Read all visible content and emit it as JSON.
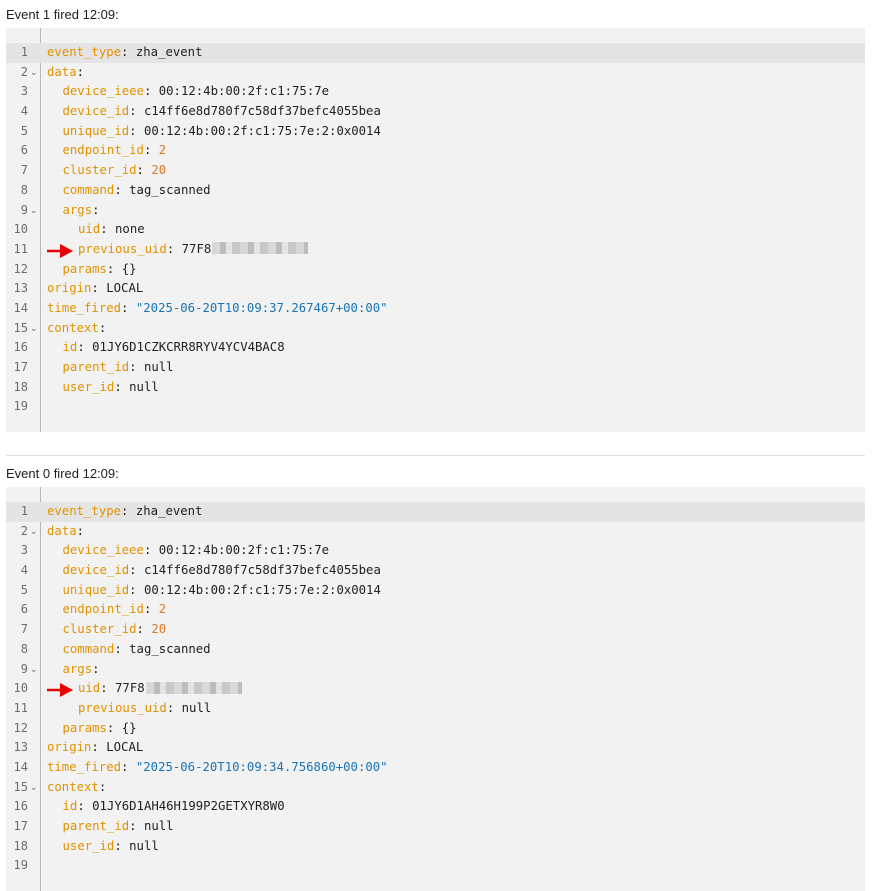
{
  "events": [
    {
      "title": "Event 1 fired 12:09:",
      "marked_line": 11,
      "lines": [
        {
          "n": "1",
          "indent": 0,
          "key": "event_type",
          "value": "zha_event",
          "vtype": "plain",
          "fold": false
        },
        {
          "n": "2",
          "indent": 0,
          "key": "data",
          "value": "",
          "vtype": "plain",
          "fold": true
        },
        {
          "n": "3",
          "indent": 1,
          "key": "device_ieee",
          "value": "00:12:4b:00:2f:c1:75:7e",
          "vtype": "plain",
          "fold": false
        },
        {
          "n": "4",
          "indent": 1,
          "key": "device_id",
          "value": "c14ff6e8d780f7c58df37befc4055bea",
          "vtype": "plain",
          "fold": false
        },
        {
          "n": "5",
          "indent": 1,
          "key": "unique_id",
          "value": "00:12:4b:00:2f:c1:75:7e:2:0x0014",
          "vtype": "plain",
          "fold": false
        },
        {
          "n": "6",
          "indent": 1,
          "key": "endpoint_id",
          "value": "2",
          "vtype": "number",
          "fold": false
        },
        {
          "n": "7",
          "indent": 1,
          "key": "cluster_id",
          "value": "20",
          "vtype": "number",
          "fold": false
        },
        {
          "n": "8",
          "indent": 1,
          "key": "command",
          "value": "tag_scanned",
          "vtype": "plain",
          "fold": false
        },
        {
          "n": "9",
          "indent": 1,
          "key": "args",
          "value": "",
          "vtype": "plain",
          "fold": true
        },
        {
          "n": "10",
          "indent": 2,
          "key": "uid",
          "value": "none",
          "vtype": "plain",
          "fold": false
        },
        {
          "n": "11",
          "indent": 2,
          "key": "previous_uid",
          "value": "77F8",
          "vtype": "redacted",
          "fold": false
        },
        {
          "n": "12",
          "indent": 1,
          "key": "params",
          "value": "{}",
          "vtype": "plain",
          "fold": false
        },
        {
          "n": "13",
          "indent": 0,
          "key": "origin",
          "value": "LOCAL",
          "vtype": "plain",
          "fold": false
        },
        {
          "n": "14",
          "indent": 0,
          "key": "time_fired",
          "value": "\"2025-06-20T10:09:37.267467+00:00\"",
          "vtype": "string",
          "fold": false
        },
        {
          "n": "15",
          "indent": 0,
          "key": "context",
          "value": "",
          "vtype": "plain",
          "fold": true
        },
        {
          "n": "16",
          "indent": 1,
          "key": "id",
          "value": "01JY6D1CZKCRR8RYV4YCV4BAC8",
          "vtype": "plain",
          "fold": false
        },
        {
          "n": "17",
          "indent": 1,
          "key": "parent_id",
          "value": "null",
          "vtype": "plain",
          "fold": false
        },
        {
          "n": "18",
          "indent": 1,
          "key": "user_id",
          "value": "null",
          "vtype": "plain",
          "fold": false
        },
        {
          "n": "19",
          "indent": 0,
          "key": "",
          "value": "",
          "vtype": "plain",
          "fold": false
        }
      ]
    },
    {
      "title": "Event 0 fired 12:09:",
      "marked_line": 10,
      "lines": [
        {
          "n": "1",
          "indent": 0,
          "key": "event_type",
          "value": "zha_event",
          "vtype": "plain",
          "fold": false
        },
        {
          "n": "2",
          "indent": 0,
          "key": "data",
          "value": "",
          "vtype": "plain",
          "fold": true
        },
        {
          "n": "3",
          "indent": 1,
          "key": "device_ieee",
          "value": "00:12:4b:00:2f:c1:75:7e",
          "vtype": "plain",
          "fold": false
        },
        {
          "n": "4",
          "indent": 1,
          "key": "device_id",
          "value": "c14ff6e8d780f7c58df37befc4055bea",
          "vtype": "plain",
          "fold": false
        },
        {
          "n": "5",
          "indent": 1,
          "key": "unique_id",
          "value": "00:12:4b:00:2f:c1:75:7e:2:0x0014",
          "vtype": "plain",
          "fold": false
        },
        {
          "n": "6",
          "indent": 1,
          "key": "endpoint_id",
          "value": "2",
          "vtype": "number",
          "fold": false
        },
        {
          "n": "7",
          "indent": 1,
          "key": "cluster_id",
          "value": "20",
          "vtype": "number",
          "fold": false
        },
        {
          "n": "8",
          "indent": 1,
          "key": "command",
          "value": "tag_scanned",
          "vtype": "plain",
          "fold": false
        },
        {
          "n": "9",
          "indent": 1,
          "key": "args",
          "value": "",
          "vtype": "plain",
          "fold": true
        },
        {
          "n": "10",
          "indent": 2,
          "key": "uid",
          "value": "77F8",
          "vtype": "redacted",
          "fold": false
        },
        {
          "n": "11",
          "indent": 2,
          "key": "previous_uid",
          "value": "null",
          "vtype": "plain",
          "fold": false
        },
        {
          "n": "12",
          "indent": 1,
          "key": "params",
          "value": "{}",
          "vtype": "plain",
          "fold": false
        },
        {
          "n": "13",
          "indent": 0,
          "key": "origin",
          "value": "LOCAL",
          "vtype": "plain",
          "fold": false
        },
        {
          "n": "14",
          "indent": 0,
          "key": "time_fired",
          "value": "\"2025-06-20T10:09:34.756860+00:00\"",
          "vtype": "string",
          "fold": false
        },
        {
          "n": "15",
          "indent": 0,
          "key": "context",
          "value": "",
          "vtype": "plain",
          "fold": true
        },
        {
          "n": "16",
          "indent": 1,
          "key": "id",
          "value": "01JY6D1AH46H199P2GETXYR8W0",
          "vtype": "plain",
          "fold": false
        },
        {
          "n": "17",
          "indent": 1,
          "key": "parent_id",
          "value": "null",
          "vtype": "plain",
          "fold": false
        },
        {
          "n": "18",
          "indent": 1,
          "key": "user_id",
          "value": "null",
          "vtype": "plain",
          "fold": false
        },
        {
          "n": "19",
          "indent": 0,
          "key": "",
          "value": "",
          "vtype": "plain",
          "fold": false
        }
      ]
    }
  ],
  "icons": {
    "fold": "chevron-down-icon",
    "marker": "red-arrow-icon"
  },
  "colors": {
    "key": "#e29200",
    "number": "#d97a2b",
    "string": "#1a73b5",
    "arrow": "#e60000"
  }
}
